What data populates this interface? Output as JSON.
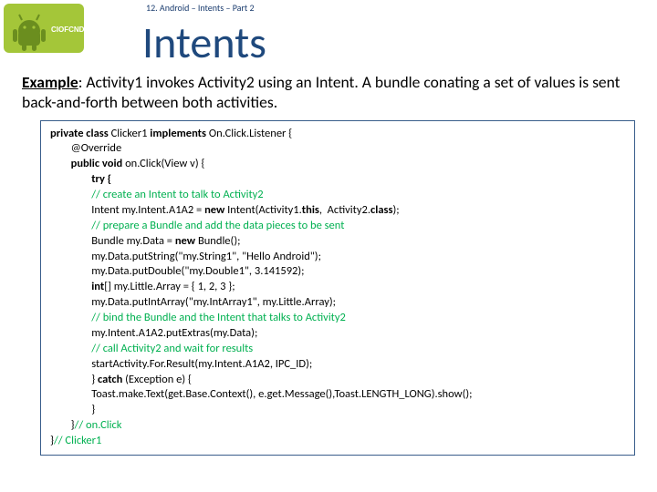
{
  "header": {
    "caption": "12. Android – Intents – Part 2",
    "title": "Intents"
  },
  "example": {
    "label": "Example",
    "text": ": Activity1 invokes Activity2 using an Intent. A bundle conating a set of values is sent back-and-forth between both activities."
  },
  "code": {
    "l01a": "private class ",
    "l01b": "Clicker1 ",
    "l01c": "implements ",
    "l01d": "On.Click.Listener {",
    "l02": "        @Override",
    "l03a": "        public void ",
    "l03b": "on.Click(View v) {",
    "l04": "                try {",
    "l05": "                // create an Intent to talk to Activity2",
    "l06a": "                Intent my.Intent.A1A2 = ",
    "l06b": "new ",
    "l06c": "Intent(Activity1.",
    "l06d": "this",
    "l06e": ",  Activity2.",
    "l06f": "class",
    "l06g": ");",
    "l07": "                // prepare a Bundle and add the data pieces to be sent",
    "l08a": "                Bundle my.Data = ",
    "l08b": "new ",
    "l08c": "Bundle();",
    "l09": "                my.Data.putString(\"my.String1\", \"Hello Android\");",
    "l10": "                my.Data.putDouble(\"my.Double1\", 3.141592);",
    "l11a": "                int",
    "l11b": "[] my.Little.Array = { 1, 2, 3 };",
    "l12": "                my.Data.putIntArray(\"my.IntArray1\", my.Little.Array);",
    "l13": "                // bind the Bundle and the Intent that talks to Activity2",
    "l14": "                my.Intent.A1A2.putExtras(my.Data);",
    "l15": "                // call Activity2 and wait for results",
    "l16": "                startActivity.For.Result(my.Intent.A1A2, IPC_ID);",
    "l17a": "                } ",
    "l17b": "catch ",
    "l17c": "(Exception e) {",
    "l18a": "                Toast.",
    "l18b": "make.Text",
    "l18c": "(get.Base.Context(), e.get.Message(),Toast.",
    "l18d": "LENGTH_LONG",
    "l18e": ").show();",
    "l19": "                }",
    "l20a": "        }",
    "l20b": "// on.Click",
    "l21a": "}",
    "l21b": "// Clicker1"
  },
  "page_number": ""
}
